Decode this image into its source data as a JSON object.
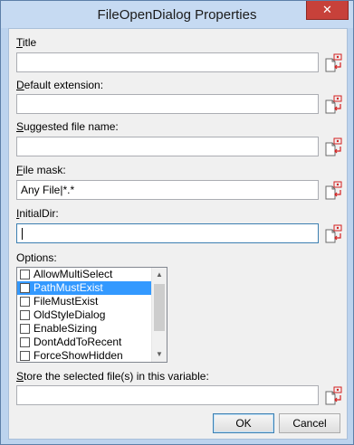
{
  "window": {
    "title": "FileOpenDialog Properties",
    "close": "✕"
  },
  "fields": {
    "title": {
      "label_accel": "T",
      "label_rest": "itle",
      "value": ""
    },
    "default_extension": {
      "label_accel": "D",
      "label_rest": "efault extension:",
      "value": ""
    },
    "suggested_file_name": {
      "label_accel": "S",
      "label_rest": "uggested  file name:",
      "value": ""
    },
    "file_mask": {
      "label_accel": "F",
      "label_rest": "ile mask:",
      "value": "Any File|*.*"
    },
    "initial_dir": {
      "label_accel": "I",
      "label_rest": "nitialDir:",
      "value": ""
    },
    "store_variable": {
      "label_accel": "S",
      "label_rest": "tore the selected file(s) in this variable:",
      "value": ""
    }
  },
  "options": {
    "label": "Options:",
    "items": [
      {
        "label": "AllowMultiSelect",
        "checked": false,
        "selected": false
      },
      {
        "label": "PathMustExist",
        "checked": false,
        "selected": true
      },
      {
        "label": "FileMustExist",
        "checked": false,
        "selected": false
      },
      {
        "label": "OldStyleDialog",
        "checked": false,
        "selected": false
      },
      {
        "label": "EnableSizing",
        "checked": false,
        "selected": false
      },
      {
        "label": "DontAddToRecent",
        "checked": false,
        "selected": false
      },
      {
        "label": "ForceShowHidden",
        "checked": false,
        "selected": false
      }
    ]
  },
  "buttons": {
    "ok": "OK",
    "cancel": "Cancel"
  },
  "icons": {
    "variable_picker": "variable-picker-icon"
  },
  "colors": {
    "selection": "#3399ff",
    "variable_icon_accent": "#d42020"
  }
}
